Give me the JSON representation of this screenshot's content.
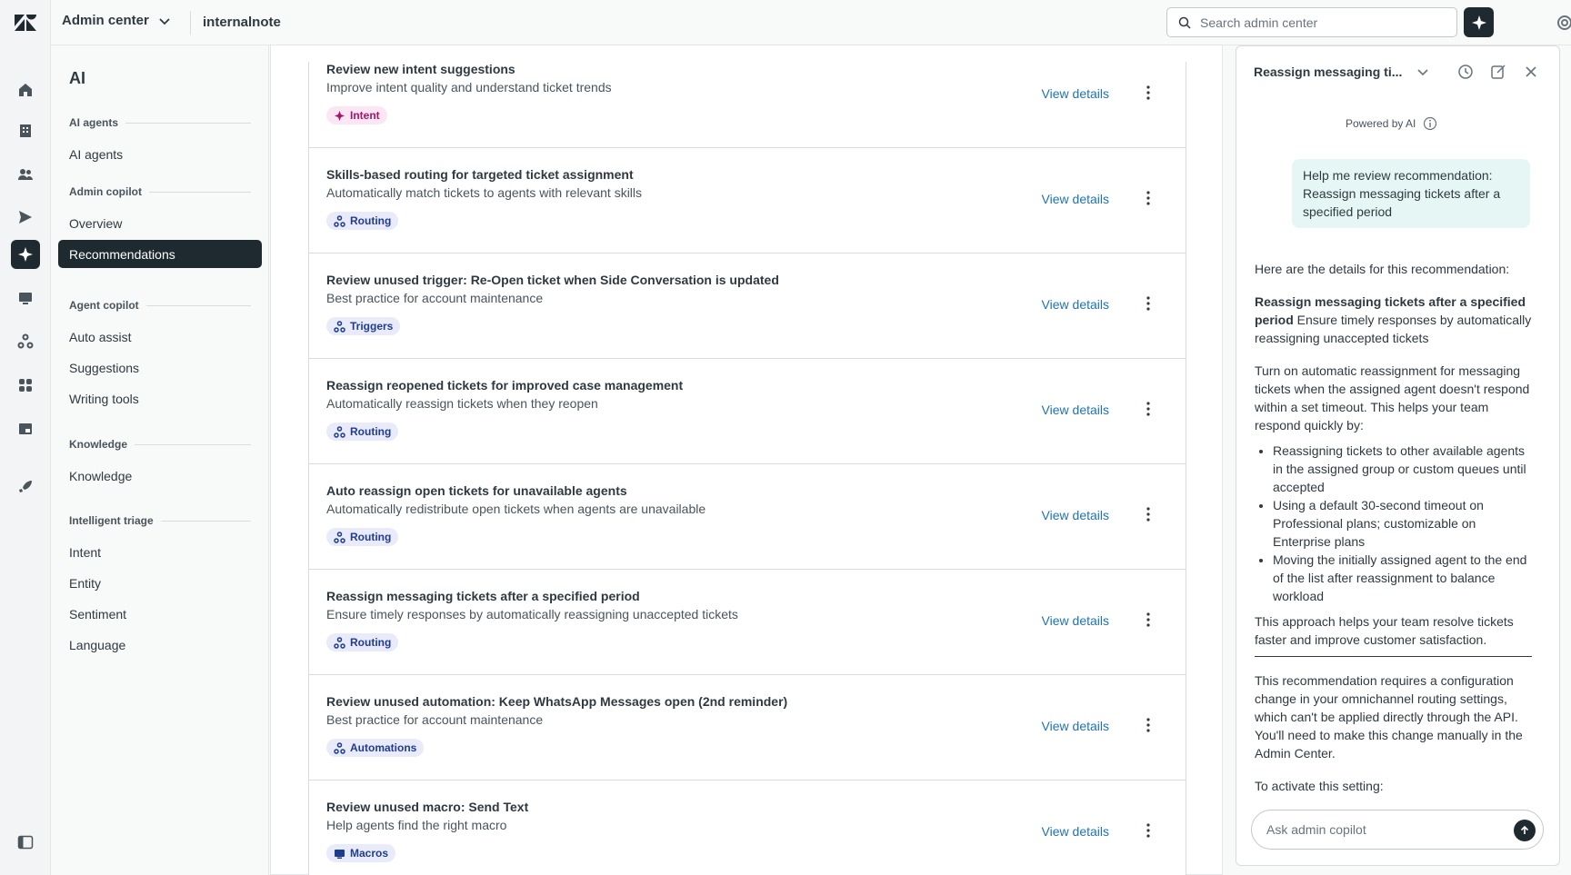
{
  "topbar": {
    "product": "Admin center",
    "subdomain": "internalnote",
    "search_placeholder": "Search admin center"
  },
  "nav": {
    "title": "AI",
    "groups": [
      {
        "label": "AI agents",
        "items": [
          "AI agents"
        ]
      },
      {
        "label": "Admin copilot",
        "items": [
          "Overview",
          "Recommendations"
        ]
      },
      {
        "label": "Agent copilot",
        "items": [
          "Auto assist",
          "Suggestions",
          "Writing tools"
        ]
      },
      {
        "label": "Knowledge",
        "items": [
          "Knowledge"
        ]
      },
      {
        "label": "Intelligent triage",
        "items": [
          "Intent",
          "Entity",
          "Sentiment",
          "Language"
        ]
      }
    ],
    "active_item": "Recommendations"
  },
  "recommendations": [
    {
      "title": "Review new intent suggestions",
      "description": "Improve intent quality and understand ticket trends",
      "tag": "Intent",
      "action": "View details"
    },
    {
      "title": "Skills-based routing for targeted ticket assignment",
      "description": "Automatically match tickets to agents with relevant skills",
      "tag": "Routing",
      "action": "View details"
    },
    {
      "title": "Review unused trigger: Re-Open ticket when Side Conversation is updated",
      "description": "Best practice for account maintenance",
      "tag": "Triggers",
      "action": "View details"
    },
    {
      "title": "Reassign reopened tickets for improved case management",
      "description": "Automatically reassign tickets when they reopen",
      "tag": "Routing",
      "action": "View details"
    },
    {
      "title": "Auto reassign open tickets for unavailable agents",
      "description": "Automatically redistribute open tickets when agents are unavailable",
      "tag": "Routing",
      "action": "View details"
    },
    {
      "title": "Reassign messaging tickets after a specified period",
      "description": "Ensure timely responses by automatically reassigning unaccepted tickets",
      "tag": "Routing",
      "action": "View details"
    },
    {
      "title": "Review unused automation: Keep WhatsApp Messages open (2nd reminder)",
      "description": "Best practice for account maintenance",
      "tag": "Automations",
      "action": "View details"
    },
    {
      "title": "Review unused macro: Send Text",
      "description": "Help agents find the right macro",
      "tag": "Macros",
      "action": "View details"
    }
  ],
  "panel": {
    "title": "Reassign messaging ti...",
    "powered": "Powered by AI",
    "user_message": "Help me review recommendation: Reassign messaging tickets after a specified period",
    "intro": "Here are the details for this recommendation:",
    "rec_title": "Reassign messaging tickets after a specified period",
    "rec_summary": " Ensure timely responses by automatically reassigning unaccepted tickets",
    "body": "Turn on automatic reassignment for messaging tickets when the assigned agent doesn't respond within a set timeout. This helps your team respond quickly by:",
    "bullets": [
      "Reassigning tickets to other available agents in the assigned group or custom queues until accepted",
      "Using a default 30-second timeout on Professional plans; customizable on Enterprise plans",
      "Moving the initially assigned agent to the end of the list after reassignment to balance workload"
    ],
    "closing": "This approach helps your team resolve tickets faster and improve customer satisfaction.",
    "note": "This recommendation requires a configuration change in your omnichannel routing settings, which can't be applied directly through the API. You'll need to make this change manually in the Admin Center.",
    "activate": "To activate this setting:",
    "ask_placeholder": "Ask admin copilot"
  }
}
